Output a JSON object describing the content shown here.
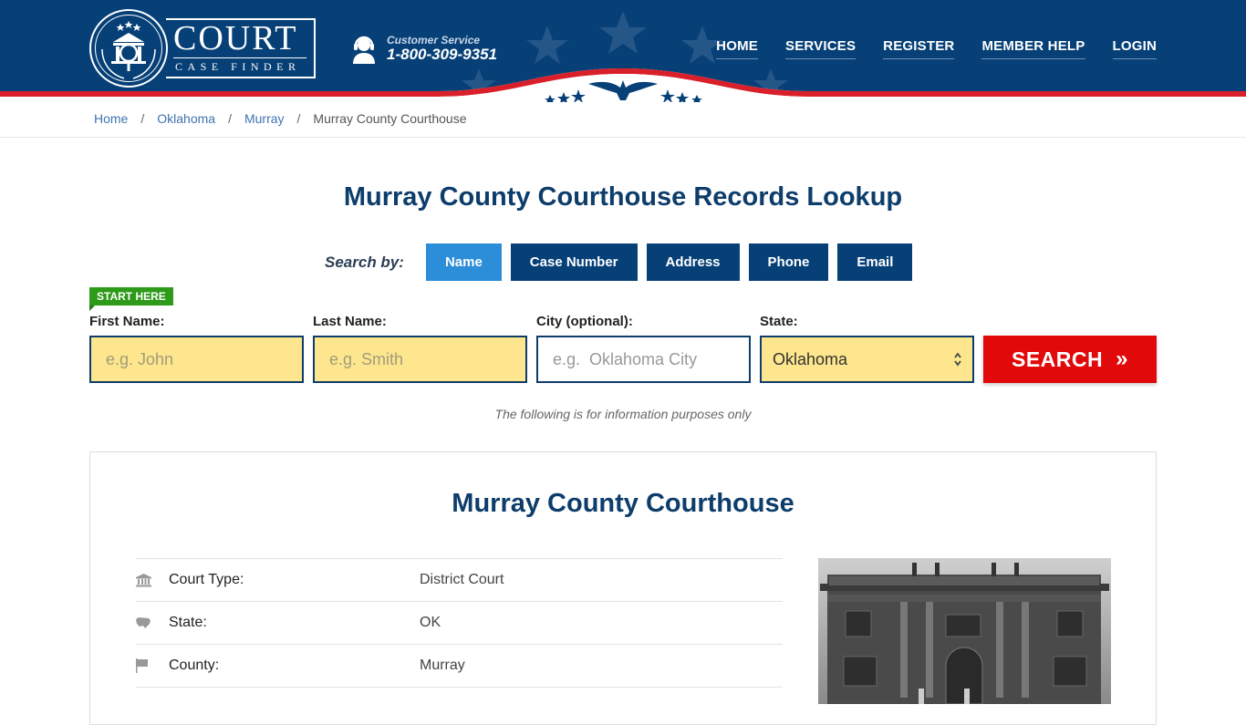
{
  "header": {
    "logo": {
      "title": "COURT",
      "subtitle": "CASE FINDER"
    },
    "customer_service": {
      "label": "Customer Service",
      "phone": "1-800-309-9351"
    },
    "nav": [
      {
        "label": "HOME"
      },
      {
        "label": "SERVICES"
      },
      {
        "label": "REGISTER"
      },
      {
        "label": "MEMBER HELP"
      },
      {
        "label": "LOGIN"
      }
    ]
  },
  "breadcrumb": {
    "items": [
      {
        "label": "Home"
      },
      {
        "label": "Oklahoma"
      },
      {
        "label": "Murray"
      }
    ],
    "current": "Murray County Courthouse",
    "separator": "/"
  },
  "page_title": "Murray County Courthouse Records Lookup",
  "search": {
    "search_by_label": "Search by:",
    "tabs": [
      {
        "label": "Name",
        "active": true
      },
      {
        "label": "Case Number",
        "active": false
      },
      {
        "label": "Address",
        "active": false
      },
      {
        "label": "Phone",
        "active": false
      },
      {
        "label": "Email",
        "active": false
      }
    ],
    "start_here": "START HERE",
    "fields": {
      "first_name": {
        "label": "First Name:",
        "placeholder": "e.g. John",
        "value": ""
      },
      "last_name": {
        "label": "Last Name:",
        "placeholder": "e.g. Smith",
        "value": ""
      },
      "city": {
        "label": "City (optional):",
        "placeholder": "e.g.  Oklahoma City",
        "value": ""
      },
      "state": {
        "label": "State:",
        "value": "Oklahoma"
      }
    },
    "button_label": "SEARCH",
    "button_icon": "»",
    "disclaimer": "The following is for information purposes only"
  },
  "courthouse": {
    "title": "Murray County Courthouse",
    "details": [
      {
        "icon": "courthouse-icon",
        "label": "Court Type:",
        "value": "District Court"
      },
      {
        "icon": "us-map-icon",
        "label": "State:",
        "value": "OK"
      },
      {
        "icon": "flag-icon",
        "label": "County:",
        "value": "Murray"
      }
    ]
  },
  "colors": {
    "brand_navy": "#064077",
    "active_tab": "#2c8dd8",
    "search_red": "#e10909",
    "input_yellow": "#fde68d",
    "start_here_green": "#2e9a1a"
  }
}
